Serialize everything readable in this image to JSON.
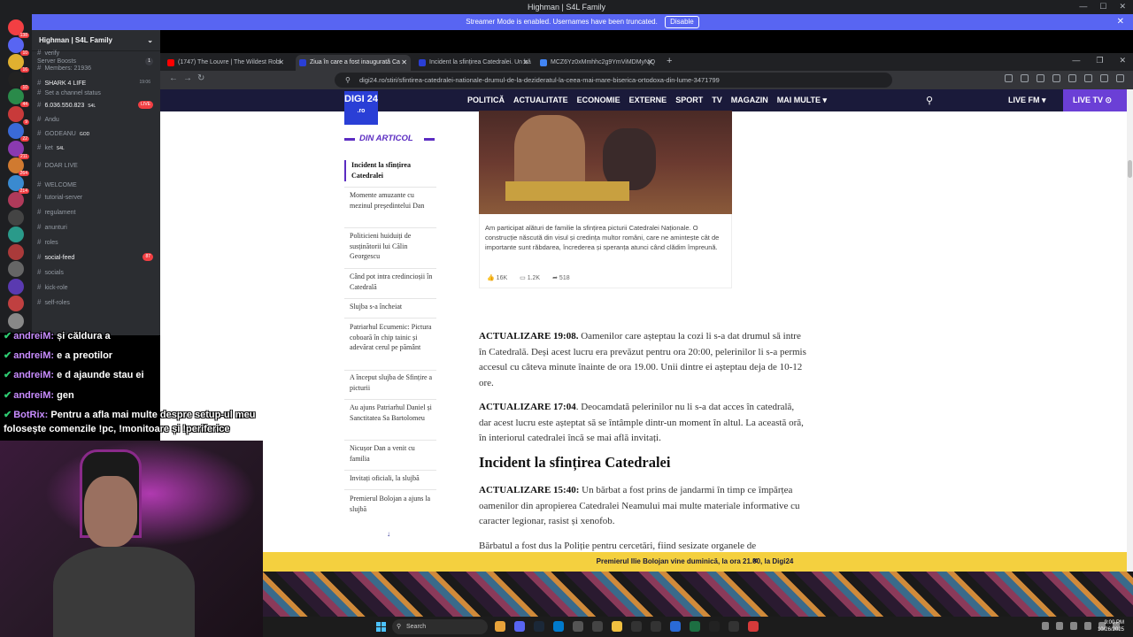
{
  "discord": {
    "window_title": "Highman | S4L Family",
    "banner_text": "Streamer Mode is enabled. Usernames have been truncated.",
    "banner_button": "Disable",
    "server_name": "Highman | S4L Family",
    "server_boosts": "Server Boosts",
    "server_boosts_count": "1",
    "channels": [
      {
        "label": "verify",
        "bold": false
      },
      {
        "label": "Members: 21936",
        "bold": false
      },
      {
        "label": "SHARK 4 LIFE",
        "bold": true,
        "time": "19:06"
      },
      {
        "label": "Set a channel status",
        "bold": false
      },
      {
        "label": "6.036.550.823",
        "bold": true,
        "tag": "S4L",
        "live": "LIVE"
      },
      {
        "label": "Andu",
        "bold": false
      },
      {
        "label": "GODEANU",
        "bold": false,
        "tag": "GOD"
      },
      {
        "label": "ket",
        "bold": false,
        "tag": "S4L"
      },
      {
        "label": "DOAR LIVE",
        "bold": false
      },
      {
        "label": "WELCOME",
        "bold": false
      },
      {
        "label": "tutorial-server",
        "bold": false
      },
      {
        "label": "regulament",
        "bold": false
      },
      {
        "label": "anunturi",
        "bold": false
      },
      {
        "label": "roles",
        "bold": false
      },
      {
        "label": "social-feed",
        "bold": true,
        "badge": "87"
      },
      {
        "label": "socials",
        "bold": false
      },
      {
        "label": "kick-role",
        "bold": false
      },
      {
        "label": "self-roles",
        "bold": false
      }
    ],
    "guild_badges": [
      "138",
      "10",
      "16",
      "10",
      "44",
      "9",
      "22",
      "211",
      "264",
      "214"
    ]
  },
  "browser": {
    "tabs": [
      {
        "label": "(1747) The Louvre | The Wildest Robl",
        "active": false,
        "fav_color": "#ff0000"
      },
      {
        "label": "Ziua în care a fost inaugurată Ca",
        "active": true,
        "fav_color": "#2a3fd6"
      },
      {
        "label": "Incident la sfințirea Catedralei. Un bă",
        "active": false,
        "fav_color": "#2a3fd6"
      },
      {
        "label": "MCZ6Yz0xMmhhc2g9YmViMDMyNjQ",
        "active": false,
        "fav_color": "#4285f4"
      }
    ],
    "url": "digi24.ro/stiri/sfintirea-catedralei-nationale-drumul-de-la-dezideratul-la-ceea-mai-mare-biserica-ortodoxa-din-lume-3471799"
  },
  "site": {
    "logo_text": "DIGI 24",
    "logo_sub": ".ro",
    "menu": [
      "POLITICĂ",
      "ACTUALITATE",
      "ECONOMIE",
      "EXTERNE",
      "SPORT",
      "TV",
      "MAGAZIN",
      "MAI MULTE ▾"
    ],
    "live_fm": "LIVE FM ▾",
    "live_tv": "LIVE TV ⊙",
    "sidebar_title": "DIN ARTICOL",
    "toc": [
      "Incident la sfințirea Catedralei",
      "Momente amuzante cu mezinul președintelui Dan",
      "Politicieni huiduiți de susținătorii lui Călin Georgescu",
      "Când pot intra credincioșii în Catedrală",
      "Slujba s-a încheiat",
      "Patriarhul Ecumenic: Pictura coboară în chip tainic și adevărat cerul pe pământ",
      "A început slujba de Sfințire a picturii",
      "Au ajuns Patriarhul Daniel și Sanctitatea Sa Bartolomeu",
      "Nicușor Dan a venit cu familia",
      "Invitați oficiali, la slujbă",
      "Premierul Bolojan a ajuns la slujbă"
    ],
    "toc_more": "↓",
    "photo_caption": "Am participat alături de familie la sfințirea picturii Catedralei Naționale. O construcție născută din visul și credința multor români, care ne amintește cât de importante sunt răbdarea, încrederea și speranța atunci când clădim împreună.",
    "photo_stats": [
      "16K",
      "1.2K",
      "518"
    ],
    "paragraphs": [
      {
        "label": "ACTUALIZARE 19:08.",
        "text": " Oamenilor care așteptau la cozi li s-a dat drumul să intre în Catedrală. Deși acest lucru era prevăzut pentru ora 20:00, pelerinilor li s-a permis accesul cu câteva minute înainte de ora 19.00. Unii dintre ei așteptau deja de 10-12 ore."
      },
      {
        "label": "ACTUALIZARE 17:04",
        "text": ". Deocamdată pelerinilor nu li s-a dat acces în catedrală, dar acest lucru este așteptat să se întâmple dintr-un moment în altul. La această oră, în interiorul catedralei încă se mai află invitați."
      },
      {
        "label": "ACTUALIZARE 15:40:",
        "text": " Un bărbat a fost prins de jandarmi în timp ce împărțea oamenilor din apropierea Catedralei Neamului mai multe materiale informative cu caracter legionar, rasist și xenofob."
      },
      {
        "label": "",
        "text": "Bărbatul a fost dus la Poliție pentru cercetări, fiind sesizate organele de"
      }
    ],
    "heading": "Incident la sfințirea Catedralei",
    "promo": "Premierul Ilie Bolojan vine duminică, la ora 21.00, la Digi24",
    "promo_close": "×"
  },
  "stream": {
    "chat": [
      {
        "name": "andreiM:",
        "msg": "și căldura a"
      },
      {
        "name": "andreiM:",
        "msg": "e a preotilor"
      },
      {
        "name": "andreiM:",
        "msg": "e d ajaunde stau ei"
      },
      {
        "name": "andreiM:",
        "msg": "gen"
      },
      {
        "name": "BotRix:",
        "msg": "Pentru a afla mai multe despre setup-ul meu"
      },
      {
        "name": "",
        "msg": "folosește comenzile !pc, !monitoare și !periferice"
      }
    ]
  },
  "taskbar": {
    "search_label": "Search",
    "time": "9:00 PM",
    "date": "10/26/2025"
  },
  "colors": {
    "accent": "#5b2cc2",
    "site_nav": "#1a1a3a",
    "promo": "#f4d03f",
    "discord_banner": "#5865f2"
  }
}
